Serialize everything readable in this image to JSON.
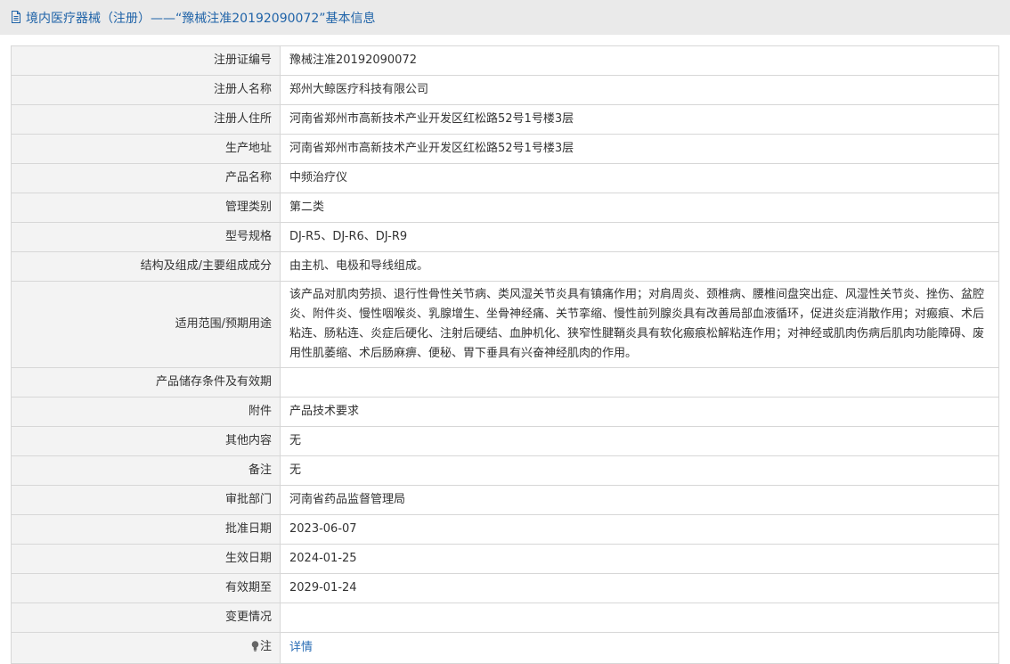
{
  "header": {
    "icon": "document-icon",
    "title": "境内医疗器械（注册）——“豫械注准20192090072”基本信息"
  },
  "rows": [
    {
      "label": "注册证编号",
      "value": "豫械注准20192090072"
    },
    {
      "label": "注册人名称",
      "value": "郑州大鲸医疗科技有限公司"
    },
    {
      "label": "注册人住所",
      "value": "河南省郑州市高新技术产业开发区红松路52号1号楼3层"
    },
    {
      "label": "生产地址",
      "value": "河南省郑州市高新技术产业开发区红松路52号1号楼3层"
    },
    {
      "label": "产品名称",
      "value": "中频治疗仪"
    },
    {
      "label": "管理类别",
      "value": "第二类"
    },
    {
      "label": "型号规格",
      "value": "DJ-R5、DJ-R6、DJ-R9"
    },
    {
      "label": "结构及组成/主要组成成分",
      "value": "由主机、电极和导线组成。"
    },
    {
      "label": "适用范围/预期用途",
      "value": "该产品对肌肉劳损、退行性骨性关节病、类风湿关节炎具有镇痛作用；对肩周炎、颈椎病、腰椎间盘突出症、风湿性关节炎、挫伤、盆腔炎、附件炎、慢性咽喉炎、乳腺增生、坐骨神经痛、关节挛缩、慢性前列腺炎具有改善局部血液循环，促进炎症消散作用；对瘢痕、术后粘连、肠粘连、炎症后硬化、注射后硬结、血肿机化、狭窄性腱鞘炎具有软化瘢痕松解粘连作用；对神经或肌肉伤病后肌肉功能障碍、废用性肌萎缩、术后肠麻痹、便秘、胃下垂具有兴奋神经肌肉的作用。"
    },
    {
      "label": "产品储存条件及有效期",
      "value": ""
    },
    {
      "label": "附件",
      "value": "产品技术要求"
    },
    {
      "label": "其他内容",
      "value": "无"
    },
    {
      "label": "备注",
      "value": "无"
    },
    {
      "label": "审批部门",
      "value": "河南省药品监督管理局"
    },
    {
      "label": "批准日期",
      "value": "2023-06-07"
    },
    {
      "label": "生效日期",
      "value": "2024-01-25"
    },
    {
      "label": "有效期至",
      "value": "2029-01-24"
    },
    {
      "label": "变更情况",
      "value": ""
    }
  ],
  "note_row": {
    "icon": "lightbulb-icon",
    "label": "注",
    "link_text": "详情"
  },
  "colors": {
    "header_bg": "#eaeaea",
    "header_text": "#1f63a8",
    "label_bg": "#f3f3f3",
    "border": "#d7d7d7",
    "link": "#2a6db5"
  }
}
